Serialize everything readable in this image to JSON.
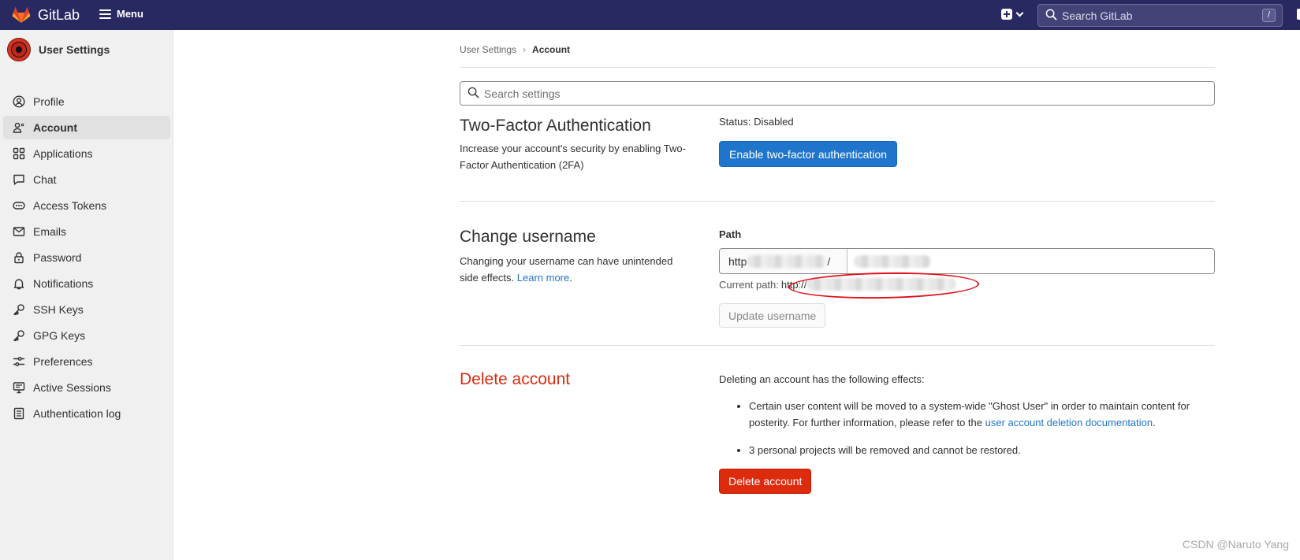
{
  "topbar": {
    "brand": "GitLab",
    "menu_label": "Menu",
    "search_placeholder": "Search GitLab",
    "search_shortcut": "/"
  },
  "sidebar": {
    "title": "User Settings",
    "items": [
      {
        "label": "Profile",
        "icon": "profile-icon",
        "active": false
      },
      {
        "label": "Account",
        "icon": "account-icon",
        "active": true
      },
      {
        "label": "Applications",
        "icon": "applications-icon",
        "active": false
      },
      {
        "label": "Chat",
        "icon": "chat-icon",
        "active": false
      },
      {
        "label": "Access Tokens",
        "icon": "token-icon",
        "active": false
      },
      {
        "label": "Emails",
        "icon": "mail-icon",
        "active": false
      },
      {
        "label": "Password",
        "icon": "lock-icon",
        "active": false
      },
      {
        "label": "Notifications",
        "icon": "bell-icon",
        "active": false
      },
      {
        "label": "SSH Keys",
        "icon": "key-icon",
        "active": false
      },
      {
        "label": "GPG Keys",
        "icon": "key-icon",
        "active": false
      },
      {
        "label": "Preferences",
        "icon": "preferences-icon",
        "active": false
      },
      {
        "label": "Active Sessions",
        "icon": "monitor-icon",
        "active": false
      },
      {
        "label": "Authentication log",
        "icon": "log-icon",
        "active": false
      }
    ]
  },
  "breadcrumb": {
    "parent": "User Settings",
    "current": "Account"
  },
  "search_settings": {
    "placeholder": "Search settings"
  },
  "two_factor": {
    "title": "Two-Factor Authentication",
    "description": "Increase your account's security by enabling Two-Factor Authentication (2FA)",
    "status": "Status: Disabled",
    "button": "Enable two-factor authentication"
  },
  "change_username": {
    "title": "Change username",
    "description": "Changing your username can have unintended side effects.",
    "learn_more": "Learn more",
    "period": ".",
    "path_label": "Path",
    "path_prefix_start": "http",
    "path_prefix_end": "/",
    "current_path_label": "Current path:",
    "current_path_value": "http://",
    "button": "Update username"
  },
  "delete_account": {
    "title": "Delete account",
    "intro": "Deleting an account has the following effects:",
    "bullet1_text": "Certain user content will be moved to a system-wide \"Ghost User\" in order to maintain content for posterity. For further information, please refer to the",
    "bullet1_link": "user account deletion documentation",
    "bullet1_end": ".",
    "bullet2": "3 personal projects will be removed and cannot be restored.",
    "button": "Delete account"
  },
  "watermark": "CSDN @Naruto Yang",
  "colors": {
    "topbar": "#292961",
    "primary": "#1f75cb",
    "danger": "#dd2b0e",
    "annotation": "#e0101a"
  }
}
